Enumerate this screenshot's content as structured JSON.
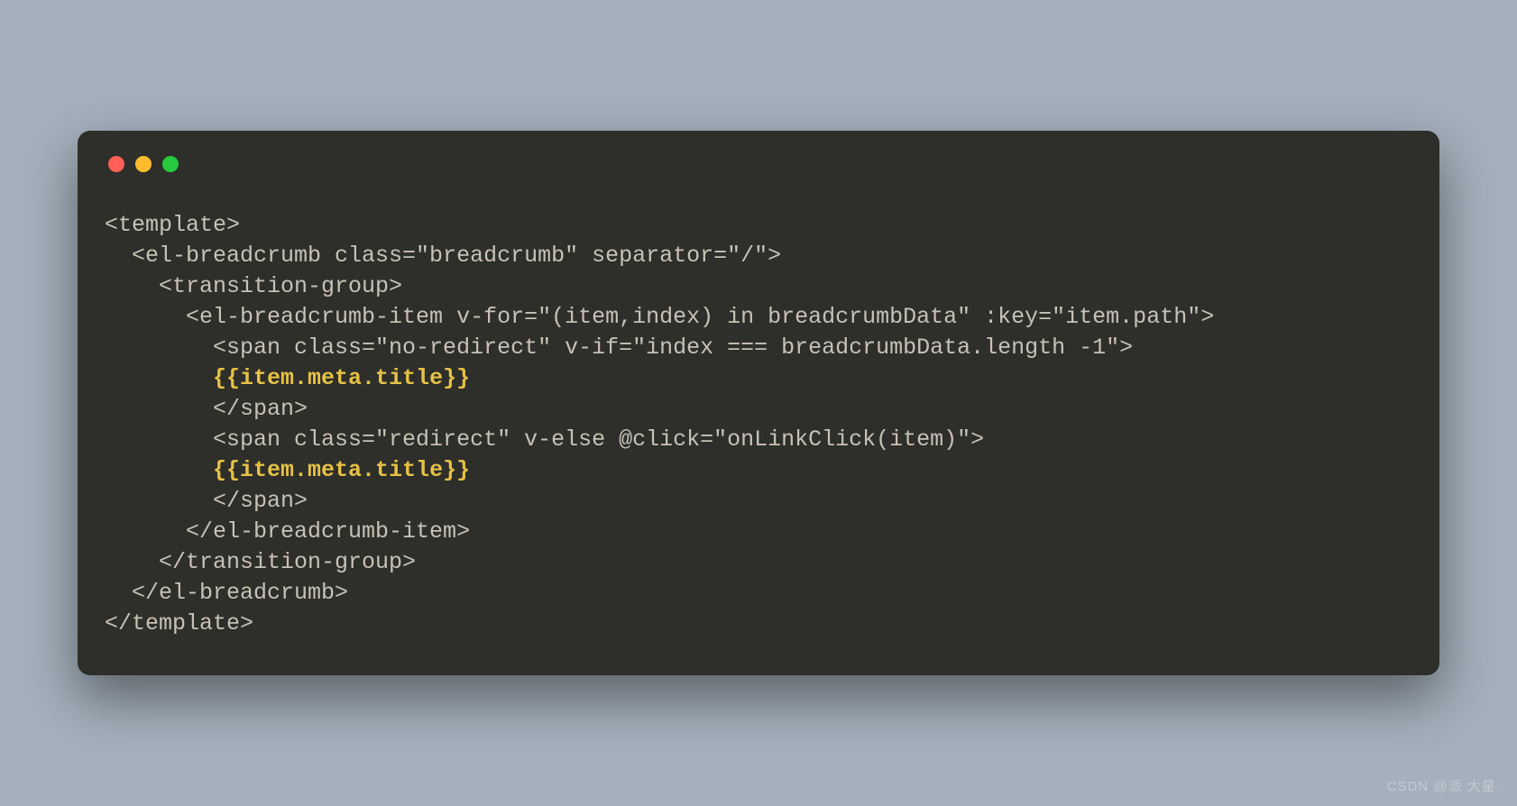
{
  "code": {
    "lines": [
      {
        "indent": 0,
        "text": "<template>",
        "highlight": false
      },
      {
        "indent": 1,
        "text": "<el-breadcrumb class=\"breadcrumb\" separator=\"/\">",
        "highlight": false
      },
      {
        "indent": 2,
        "text": "<transition-group>",
        "highlight": false
      },
      {
        "indent": 3,
        "text": "<el-breadcrumb-item v-for=\"(item,index) in breadcrumbData\" :key=\"item.path\">",
        "highlight": false
      },
      {
        "indent": 4,
        "text": "<span class=\"no-redirect\" v-if=\"index === breadcrumbData.length -1\">",
        "highlight": false
      },
      {
        "indent": 4,
        "text": "{{item.meta.title}}",
        "highlight": true
      },
      {
        "indent": 4,
        "text": "</span>",
        "highlight": false
      },
      {
        "indent": 4,
        "text": "<span class=\"redirect\" v-else @click=\"onLinkClick(item)\">",
        "highlight": false
      },
      {
        "indent": 4,
        "text": "{{item.meta.title}}",
        "highlight": true
      },
      {
        "indent": 4,
        "text": "</span>",
        "highlight": false
      },
      {
        "indent": 3,
        "text": "</el-breadcrumb-item>",
        "highlight": false
      },
      {
        "indent": 2,
        "text": "</transition-group>",
        "highlight": false
      },
      {
        "indent": 1,
        "text": "</el-breadcrumb>",
        "highlight": false
      },
      {
        "indent": 0,
        "text": "</template>",
        "highlight": false
      }
    ],
    "indent_unit": "  "
  },
  "watermark": "CSDN @派 大星."
}
